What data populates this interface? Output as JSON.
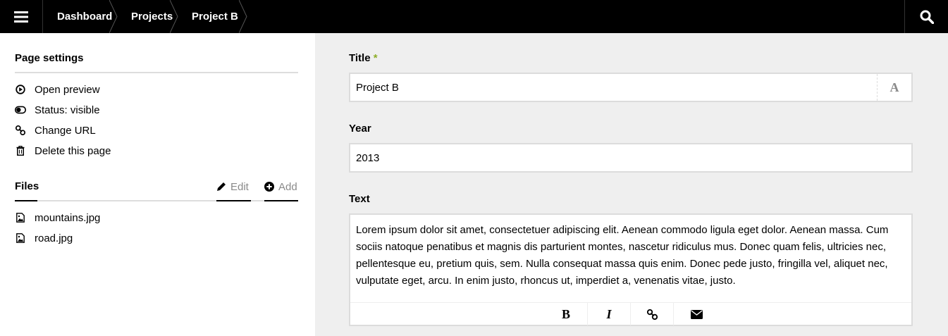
{
  "topbar": {
    "breadcrumbs": [
      {
        "label": "Dashboard"
      },
      {
        "label": "Projects"
      },
      {
        "label": "Project B"
      }
    ]
  },
  "sidebar": {
    "page_settings": {
      "heading": "Page settings",
      "options": [
        {
          "label": "Open preview",
          "icon": "play-circle-icon"
        },
        {
          "label": "Status: visible",
          "icon": "toggle-icon"
        },
        {
          "label": "Change URL",
          "icon": "chain-link-icon"
        },
        {
          "label": "Delete this page",
          "icon": "trash-icon"
        }
      ]
    },
    "files": {
      "heading": "Files",
      "edit_label": "Edit",
      "add_label": "Add",
      "items": [
        {
          "name": "mountains.jpg",
          "icon": "image-file-icon"
        },
        {
          "name": "road.jpg",
          "icon": "image-file-icon"
        }
      ]
    }
  },
  "form": {
    "title": {
      "label": "Title",
      "required_mark": "*",
      "value": "Project B",
      "tool_glyph": "A"
    },
    "year": {
      "label": "Year",
      "value": "2013"
    },
    "text": {
      "label": "Text",
      "value": "Lorem ipsum dolor sit amet, consectetuer adipiscing elit. Aenean commodo ligula eget dolor. Aenean massa. Cum sociis natoque penatibus et magnis dis parturient montes, nascetur ridiculus mus. Donec quam felis, ultricies nec, pellentesque eu, pretium quis, sem. Nulla consequat massa quis enim. Donec pede justo, fringilla vel, aliquet nec, vulputate eget, arcu. In enim justo, rhoncus ut, imperdiet a, venenatis vitae, justo.",
      "toolbar": {
        "bold": "B",
        "italic": "I"
      }
    }
  },
  "colors": {
    "topbar": "#000000",
    "main_bg": "#efefef",
    "required": "#8dae28",
    "muted": "#8a8a8a"
  }
}
